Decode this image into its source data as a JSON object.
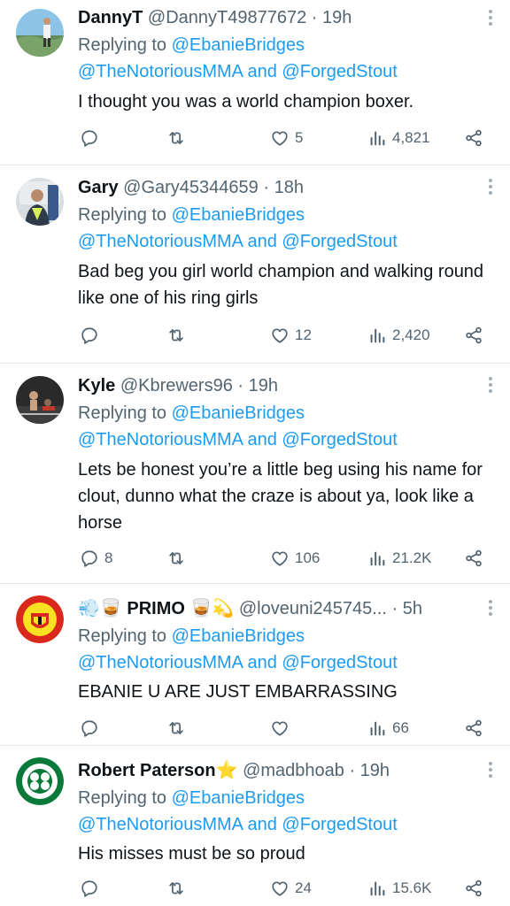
{
  "replying_label": "Replying to",
  "replying_to": "@EbanieBridges",
  "mention_a": "@TheNotoriousMMA",
  "mention_and": " and ",
  "mention_b": "@ForgedStout",
  "tweets": [
    {
      "name": "DannyT",
      "handle": "@DannyT49877672",
      "time": "19h",
      "text": "I thought you was a world champion boxer.",
      "replies": "",
      "likes": "5",
      "views": "4,821"
    },
    {
      "name": "Gary",
      "handle": "@Gary45344659",
      "time": "18h",
      "text": "Bad beg you girl world champion and walking round like one of his ring girls",
      "replies": "",
      "likes": "12",
      "views": "2,420"
    },
    {
      "name": "Kyle",
      "handle": "@Kbrewers96",
      "time": "19h",
      "text": "Lets be honest you’re a little beg using his name for clout, dunno what the craze is about ya, look like a horse",
      "replies": "8",
      "likes": "106",
      "views": "21.2K"
    },
    {
      "name": "PRIMO",
      "handle": "@loveuni245745...",
      "time": "5h",
      "text": "EBANIE U ARE JUST EMBARRASSING",
      "replies": "",
      "likes": "",
      "views": "66"
    },
    {
      "name": "Robert Paterson",
      "handle": "@madbhoab",
      "time": "19h",
      "text": "His misses must be so proud",
      "replies": "",
      "likes": "24",
      "views": "15.6K"
    }
  ],
  "icons": {
    "reply": "reply-icon",
    "retweet": "retweet-icon",
    "like": "heart-icon",
    "views": "views-icon",
    "share": "share-icon",
    "more": "more-icon"
  },
  "colors": {
    "link": "#1d9bf0",
    "secondary_text": "#536471",
    "primary_text": "#0f1419",
    "divider": "#e6e9ec"
  }
}
